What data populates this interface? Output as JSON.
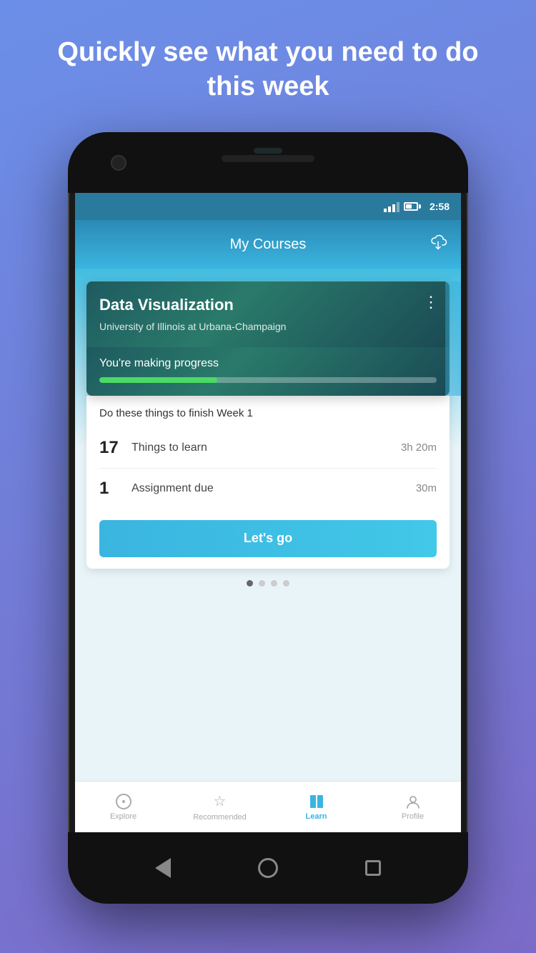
{
  "hero": {
    "title": "Quickly see what you need to do this week"
  },
  "status_bar": {
    "time": "2:58"
  },
  "app_header": {
    "title": "My Courses"
  },
  "course_card": {
    "title": "Data Visualization",
    "subtitle": "University of Illinois at Urbana-Champaign",
    "progress_label": "You're making progress",
    "progress_percent": 35
  },
  "week_section": {
    "week_label": "Do these things to finish Week 1",
    "tasks": [
      {
        "number": "17",
        "name": "Things to learn",
        "duration": "3h 20m"
      },
      {
        "number": "1",
        "name": "Assignment due",
        "duration": "30m"
      }
    ],
    "cta_button": "Let's go"
  },
  "bottom_nav": {
    "items": [
      {
        "id": "explore",
        "label": "Explore",
        "active": false
      },
      {
        "id": "recommended",
        "label": "Recommended",
        "active": false
      },
      {
        "id": "learn",
        "label": "Learn",
        "active": true
      },
      {
        "id": "profile",
        "label": "Profile",
        "active": false
      }
    ]
  }
}
